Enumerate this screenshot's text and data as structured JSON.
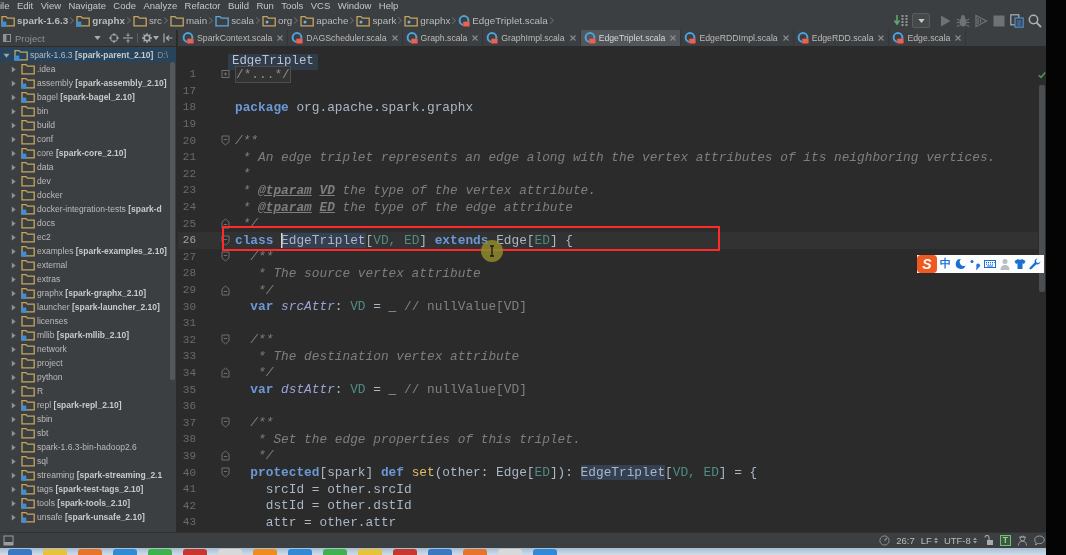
{
  "menu": [
    "ile",
    "Edit",
    "View",
    "Navigate",
    "Code",
    "Analyze",
    "Refactor",
    "Build",
    "Run",
    "Tools",
    "VCS",
    "Window",
    "Help"
  ],
  "navbar": {
    "crumbs": [
      {
        "label": "spark-1.6.3",
        "kind": "module"
      },
      {
        "label": "graphx",
        "kind": "module"
      },
      {
        "label": "src",
        "kind": "folder"
      },
      {
        "label": "main",
        "kind": "folder"
      },
      {
        "label": "scala",
        "kind": "source_root"
      },
      {
        "label": "org",
        "kind": "package"
      },
      {
        "label": "apache",
        "kind": "package"
      },
      {
        "label": "spark",
        "kind": "package"
      },
      {
        "label": "graphx",
        "kind": "package"
      },
      {
        "label": "EdgeTriplet.scala",
        "kind": "file"
      }
    ]
  },
  "toolbar": {
    "buttons": [
      {
        "kind": "build",
        "disabled": false
      },
      {
        "kind": "config_dropdown",
        "disabled": false
      },
      {
        "kind": "run",
        "disabled": true
      },
      {
        "kind": "debug",
        "disabled": true
      },
      {
        "kind": "coverage",
        "disabled": true
      },
      {
        "kind": "stop",
        "disabled": true
      },
      {
        "kind": "project_structure",
        "disabled": false
      },
      {
        "kind": "search",
        "disabled": false
      }
    ]
  },
  "project_panel": {
    "title": "Project",
    "tree": {
      "label": "spark-1.6.3 **[spark-parent_2.10]**",
      "path": "D:\\",
      "kind": "module",
      "expanded": true,
      "selected": true,
      "children": [
        {
          "label": ".idea",
          "kind": "folder",
          "expanded": false,
          "selected": false
        },
        {
          "label": "assembly **[spark-assembly_2.10]**",
          "kind": "module",
          "expanded": false,
          "selected": false
        },
        {
          "label": "bagel **[spark-bagel_2.10]**",
          "kind": "module",
          "expanded": false,
          "selected": false
        },
        {
          "label": "bin",
          "kind": "folder",
          "expanded": false,
          "selected": false
        },
        {
          "label": "build",
          "kind": "folder",
          "expanded": false,
          "selected": false
        },
        {
          "label": "conf",
          "kind": "folder",
          "expanded": false,
          "selected": false
        },
        {
          "label": "core **[spark-core_2.10]**",
          "kind": "module",
          "expanded": false,
          "selected": false
        },
        {
          "label": "data",
          "kind": "folder",
          "expanded": false,
          "selected": false
        },
        {
          "label": "dev",
          "kind": "folder",
          "expanded": false,
          "selected": false
        },
        {
          "label": "docker",
          "kind": "folder",
          "expanded": false,
          "selected": false
        },
        {
          "label": "docker-integration-tests **[spark-d**",
          "kind": "module",
          "expanded": false,
          "selected": false
        },
        {
          "label": "docs",
          "kind": "folder",
          "expanded": false,
          "selected": false
        },
        {
          "label": "ec2",
          "kind": "folder",
          "expanded": false,
          "selected": false
        },
        {
          "label": "examples **[spark-examples_2.10]**",
          "kind": "module",
          "expanded": false,
          "selected": false
        },
        {
          "label": "external",
          "kind": "folder",
          "expanded": false,
          "selected": false
        },
        {
          "label": "extras",
          "kind": "folder",
          "expanded": false,
          "selected": false
        },
        {
          "label": "graphx **[spark-graphx_2.10]**",
          "kind": "module",
          "expanded": false,
          "selected": false
        },
        {
          "label": "launcher **[spark-launcher_2.10]**",
          "kind": "module",
          "expanded": false,
          "selected": false
        },
        {
          "label": "licenses",
          "kind": "folder",
          "expanded": false,
          "selected": false
        },
        {
          "label": "mllib **[spark-mllib_2.10]**",
          "kind": "module",
          "expanded": false,
          "selected": false
        },
        {
          "label": "network",
          "kind": "folder",
          "expanded": false,
          "selected": false
        },
        {
          "label": "project",
          "kind": "folder",
          "expanded": false,
          "selected": false
        },
        {
          "label": "python",
          "kind": "folder",
          "expanded": false,
          "selected": false
        },
        {
          "label": "R",
          "kind": "folder",
          "expanded": false,
          "selected": false
        },
        {
          "label": "repl **[spark-repl_2.10]**",
          "kind": "module",
          "expanded": false,
          "selected": false
        },
        {
          "label": "sbin",
          "kind": "folder",
          "expanded": false,
          "selected": false
        },
        {
          "label": "sbt",
          "kind": "folder",
          "expanded": false,
          "selected": false
        },
        {
          "label": "spark-1.6.3-bin-hadoop2.6",
          "kind": "folder",
          "expanded": false,
          "selected": false
        },
        {
          "label": "sql",
          "kind": "folder",
          "expanded": false,
          "selected": false
        },
        {
          "label": "streaming **[spark-streaming_2.1**",
          "kind": "module",
          "expanded": false,
          "selected": false
        },
        {
          "label": "tags **[spark-test-tags_2.10]**",
          "kind": "module",
          "expanded": false,
          "selected": false
        },
        {
          "label": "tools **[spark-tools_2.10]**",
          "kind": "module",
          "expanded": false,
          "selected": false
        },
        {
          "label": "unsafe **[spark-unsafe_2.10]**",
          "kind": "module",
          "expanded": false,
          "selected": false
        }
      ]
    }
  },
  "editor": {
    "tabs": [
      {
        "label": "SparkContext.scala",
        "selected": false
      },
      {
        "label": "DAGScheduler.scala",
        "selected": false
      },
      {
        "label": "Graph.scala",
        "selected": false
      },
      {
        "label": "GraphImpl.scala",
        "selected": false
      },
      {
        "label": "EdgeTriplet.scala",
        "selected": true
      },
      {
        "label": "EdgeRDDImpl.scala",
        "selected": false
      },
      {
        "label": "EdgeRDD.scala",
        "selected": false
      },
      {
        "label": "Edge.scala",
        "selected": false
      }
    ],
    "header": "EdgeTriplet",
    "lines": [
      {
        "number": "1",
        "kind": "folded",
        "current": false,
        "tokens": [
          {
            "text": "/*...*/",
            "kind": "folded"
          }
        ]
      },
      {
        "number": "17",
        "kind": "plain",
        "current": false
      },
      {
        "number": "18",
        "kind": "plain",
        "current": false,
        "tokens": [
          {
            "text": "package",
            "kind": "keyword"
          },
          {
            "text": " org.apache.spark.graphx",
            "kind": "plain"
          }
        ]
      },
      {
        "number": "19",
        "kind": "plain",
        "current": false
      },
      {
        "number": "20",
        "kind": "fold_start",
        "current": false,
        "tokens": [
          {
            "text": "/**",
            "kind": "doc"
          }
        ]
      },
      {
        "number": "21",
        "kind": "plain",
        "current": false,
        "tokens": [
          {
            "text": " * An edge triplet represents an edge along with the vertex attributes of its neighboring vertices.",
            "kind": "doc"
          }
        ]
      },
      {
        "number": "22",
        "kind": "plain",
        "current": false,
        "tokens": [
          {
            "text": " *",
            "kind": "doc"
          }
        ]
      },
      {
        "number": "23",
        "kind": "plain",
        "current": false,
        "tokens": [
          {
            "text": " * ",
            "kind": "doc"
          },
          {
            "text": "@tparam ",
            "kind": "doc_tag"
          },
          {
            "text": "VD",
            "kind": "doc_param"
          },
          {
            "text": " the type of the vertex attribute.",
            "kind": "doc"
          }
        ]
      },
      {
        "number": "24",
        "kind": "plain",
        "current": false,
        "tokens": [
          {
            "text": " * ",
            "kind": "doc"
          },
          {
            "text": "@tparam ",
            "kind": "doc_tag"
          },
          {
            "text": "ED",
            "kind": "doc_param"
          },
          {
            "text": " the type of the edge attribute",
            "kind": "doc"
          }
        ]
      },
      {
        "number": "25",
        "kind": "fold_end",
        "current": false,
        "tokens": [
          {
            "text": " */",
            "kind": "doc"
          }
        ]
      },
      {
        "number": "26",
        "kind": "fold_start",
        "current": true,
        "tokens": [
          {
            "text": "class ",
            "kind": "keyword"
          },
          {
            "text": "EdgeTriplet",
            "kind": "usage_caret"
          },
          {
            "text": "[",
            "kind": "plain"
          },
          {
            "text": "VD, ED",
            "kind": "type_param"
          },
          {
            "text": "] ",
            "kind": "plain"
          },
          {
            "text": "extends",
            "kind": "keyword"
          },
          {
            "text": " Edge[",
            "kind": "plain"
          },
          {
            "text": "ED",
            "kind": "type_param"
          },
          {
            "text": "] {",
            "kind": "plain"
          }
        ]
      },
      {
        "number": "27",
        "kind": "fold_start",
        "current": false,
        "tokens": [
          {
            "text": "  /**",
            "kind": "doc"
          }
        ]
      },
      {
        "number": "28",
        "kind": "plain",
        "current": false,
        "tokens": [
          {
            "text": "   * The source vertex attribute",
            "kind": "doc"
          }
        ]
      },
      {
        "number": "29",
        "kind": "fold_end",
        "current": false,
        "tokens": [
          {
            "text": "   */",
            "kind": "doc"
          }
        ]
      },
      {
        "number": "30",
        "kind": "plain",
        "current": false,
        "tokens": [
          {
            "text": "  var ",
            "kind": "keyword"
          },
          {
            "text": "srcAttr",
            "kind": "field"
          },
          {
            "text": ": ",
            "kind": "plain"
          },
          {
            "text": "VD",
            "kind": "type_param"
          },
          {
            "text": " = _ ",
            "kind": "plain"
          },
          {
            "text": "// nullValue[VD]",
            "kind": "line_comment"
          }
        ]
      },
      {
        "number": "31",
        "kind": "plain",
        "current": false
      },
      {
        "number": "32",
        "kind": "fold_start",
        "current": false,
        "tokens": [
          {
            "text": "  /**",
            "kind": "doc"
          }
        ]
      },
      {
        "number": "33",
        "kind": "plain",
        "current": false,
        "tokens": [
          {
            "text": "   * The destination vertex attribute",
            "kind": "doc"
          }
        ]
      },
      {
        "number": "34",
        "kind": "fold_end",
        "current": false,
        "tokens": [
          {
            "text": "   */",
            "kind": "doc"
          }
        ]
      },
      {
        "number": "35",
        "kind": "plain",
        "current": false,
        "tokens": [
          {
            "text": "  var ",
            "kind": "keyword"
          },
          {
            "text": "dstAttr",
            "kind": "field"
          },
          {
            "text": ": ",
            "kind": "plain"
          },
          {
            "text": "VD",
            "kind": "type_param"
          },
          {
            "text": " = _ ",
            "kind": "plain"
          },
          {
            "text": "// nullValue[VD]",
            "kind": "line_comment"
          }
        ]
      },
      {
        "number": "36",
        "kind": "plain",
        "current": false
      },
      {
        "number": "37",
        "kind": "fold_start",
        "current": false,
        "tokens": [
          {
            "text": "  /**",
            "kind": "doc"
          }
        ]
      },
      {
        "number": "38",
        "kind": "plain",
        "current": false,
        "tokens": [
          {
            "text": "   * Set the edge properties of this triplet.",
            "kind": "doc"
          }
        ]
      },
      {
        "number": "39",
        "kind": "fold_end",
        "current": false,
        "tokens": [
          {
            "text": "   */",
            "kind": "doc"
          }
        ]
      },
      {
        "number": "40",
        "kind": "fold_start",
        "current": false,
        "tokens": [
          {
            "text": "  protected",
            "kind": "keyword"
          },
          {
            "text": "[spark] ",
            "kind": "plain"
          },
          {
            "text": "def ",
            "kind": "keyword"
          },
          {
            "text": "set",
            "kind": "method"
          },
          {
            "text": "(other: Edge[",
            "kind": "plain"
          },
          {
            "text": "ED",
            "kind": "type_param"
          },
          {
            "text": "]): ",
            "kind": "plain"
          },
          {
            "text": "EdgeTriplet",
            "kind": "usage"
          },
          {
            "text": "[",
            "kind": "plain"
          },
          {
            "text": "VD, ED",
            "kind": "type_param"
          },
          {
            "text": "] = {",
            "kind": "plain"
          }
        ]
      },
      {
        "number": "41",
        "kind": "plain",
        "current": false,
        "tokens": [
          {
            "text": "    srcId = other.srcId",
            "kind": "plain"
          }
        ]
      },
      {
        "number": "42",
        "kind": "plain",
        "current": false,
        "tokens": [
          {
            "text": "    dstId = other.dstId",
            "kind": "plain"
          }
        ]
      },
      {
        "number": "43",
        "kind": "plain",
        "current": false,
        "tokens": [
          {
            "text": "    attr = other.attr",
            "kind": "plain"
          }
        ]
      }
    ]
  },
  "ime_toolbar": {
    "logo": "S",
    "mode": "中"
  },
  "status_bar": {
    "position": "26:7",
    "line_separator": "LF",
    "encoding": "UTF-8",
    "badge": "T"
  }
}
